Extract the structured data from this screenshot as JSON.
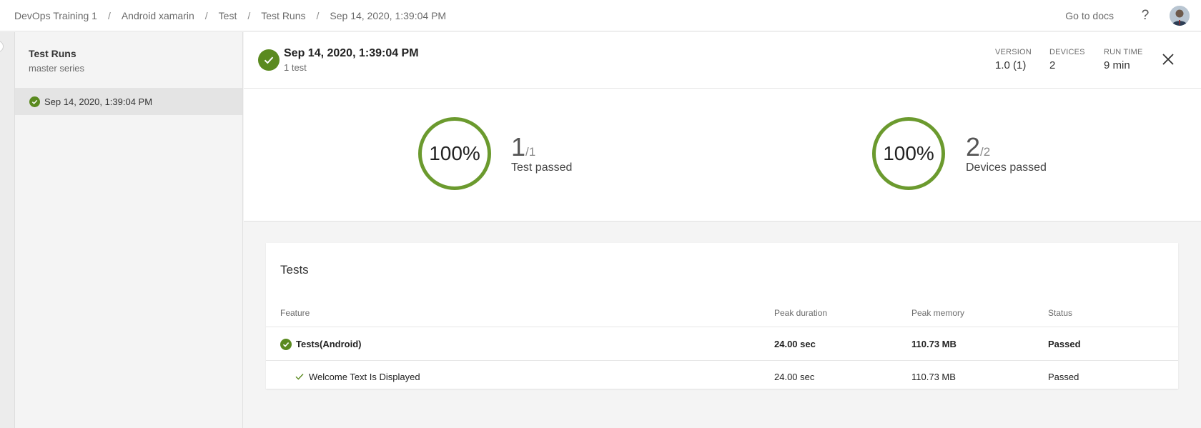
{
  "breadcrumb": [
    "DevOps Training 1",
    "Android xamarin",
    "Test",
    "Test Runs",
    "Sep 14, 2020, 1:39:04 PM"
  ],
  "topbar": {
    "docs_label": "Go to docs",
    "help_label": "?"
  },
  "sidebar": {
    "title": "Test Runs",
    "subtitle": "master series",
    "items": [
      {
        "label": "Sep 14, 2020, 1:39:04 PM",
        "status": "passed"
      }
    ]
  },
  "run": {
    "title": "Sep 14, 2020, 1:39:04 PM",
    "subtitle": "1 test",
    "meta": [
      {
        "label": "VERSION",
        "value": "1.0 (1)"
      },
      {
        "label": "DEVICES",
        "value": "2"
      },
      {
        "label": "RUN TIME",
        "value": "9 min"
      }
    ]
  },
  "summary": {
    "tests": {
      "percent": "100%",
      "passed": "1",
      "total": "/1",
      "label": "Test passed"
    },
    "devices": {
      "percent": "100%",
      "passed": "2",
      "total": "/2",
      "label": "Devices passed"
    }
  },
  "tests": {
    "title": "Tests",
    "columns": [
      "Feature",
      "Peak duration",
      "Peak memory",
      "Status"
    ],
    "rows": [
      {
        "feature": "Tests(Android)",
        "duration": "24.00 sec",
        "memory": "110.73 MB",
        "status": "Passed"
      },
      {
        "feature": "Welcome Text Is Displayed",
        "duration": "24.00 sec",
        "memory": "110.73 MB",
        "status": "Passed"
      }
    ]
  },
  "colors": {
    "success": "#5a8a1f",
    "ring": "#6b9a2e"
  }
}
